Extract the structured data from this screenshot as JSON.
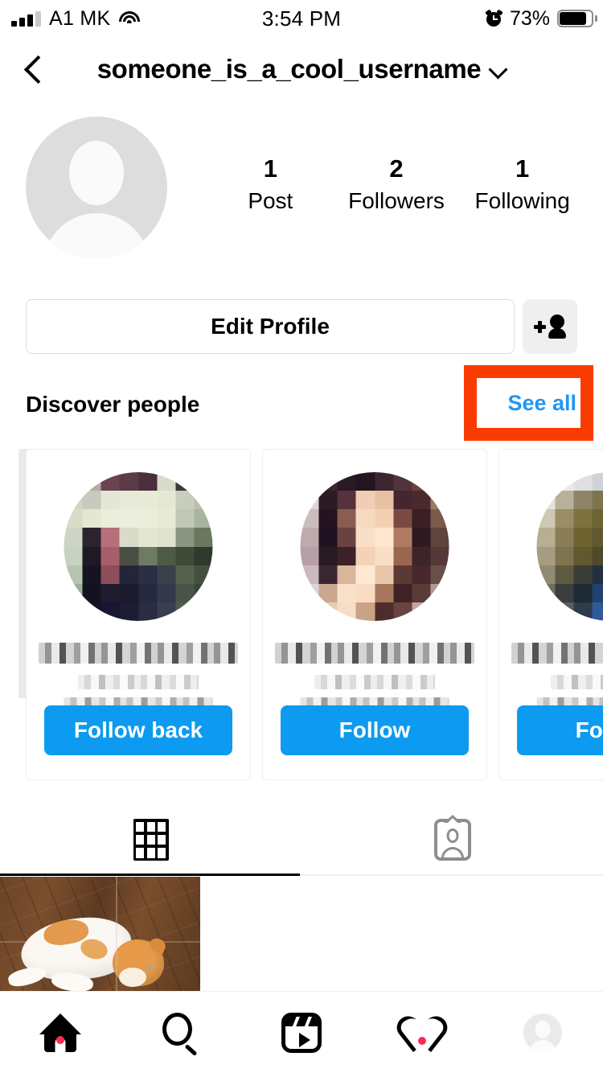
{
  "status_bar": {
    "carrier": "A1 MK",
    "time": "3:54 PM",
    "battery_percent": "73%",
    "battery_level": 73,
    "signal_bars_filled": 3,
    "signal_bars_total": 4,
    "icons": [
      "signal-icon",
      "wifi-icon",
      "alarm-clock-icon",
      "battery-icon"
    ]
  },
  "header": {
    "back_icon": "back-chevron-icon",
    "username": "someone_is_a_cool_username",
    "dropdown_icon": "chevron-down-icon"
  },
  "profile": {
    "avatar_icon": "default-avatar-placeholder",
    "stats": [
      {
        "count": "1",
        "label": "Post"
      },
      {
        "count": "2",
        "label": "Followers"
      },
      {
        "count": "1",
        "label": "Following"
      }
    ]
  },
  "actions": {
    "edit_profile_label": "Edit Profile",
    "discover_people_icon": "add-person-icon"
  },
  "discover": {
    "title": "Discover people",
    "see_all_label": "See all",
    "highlight_color": "#fa3c00",
    "link_color": "#0095f6",
    "cards": [
      {
        "name_hidden": true,
        "username_hidden": true,
        "subtitle_hidden": true,
        "button_label": "Follow back",
        "photo": "blurred-profile-photo-landscape"
      },
      {
        "name_hidden": true,
        "username_hidden": true,
        "subtitle_hidden": true,
        "button_label": "Follow",
        "photo": "blurred-profile-photo-curly-hair"
      },
      {
        "name_hidden": true,
        "username_hidden": true,
        "subtitle_hidden": true,
        "button_label": "Follow",
        "photo": "blurred-profile-photo-outdoor"
      }
    ],
    "button_color": "#0c9bf0"
  },
  "tabs": [
    {
      "icon": "grid-icon",
      "active": true
    },
    {
      "icon": "tagged-person-icon",
      "active": false
    }
  ],
  "posts": [
    {
      "alt": "orange-and-white-cat-sleeping-on-wooden-floor"
    }
  ],
  "bottom_nav": [
    {
      "icon": "home-icon",
      "active": true,
      "badge": true
    },
    {
      "icon": "search-icon",
      "active": false,
      "badge": false
    },
    {
      "icon": "reels-icon",
      "active": false,
      "badge": false
    },
    {
      "icon": "heart-icon",
      "active": false,
      "badge": true
    },
    {
      "icon": "profile-avatar-icon",
      "active": false,
      "badge": false
    }
  ]
}
